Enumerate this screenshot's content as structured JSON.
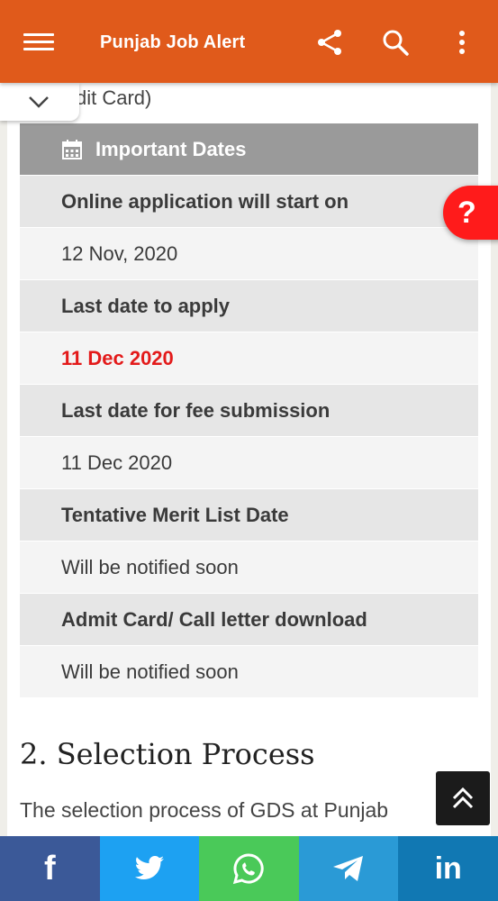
{
  "appbar": {
    "title": "Punjab Job Alert",
    "icons": [
      "menu-icon",
      "share-icon",
      "search-icon",
      "more-vert-icon"
    ]
  },
  "partial_text": "dit Card)",
  "table": {
    "heading": "Important Dates",
    "rows": [
      {
        "label": "Online application will start on",
        "value": "12 Nov, 2020"
      },
      {
        "label": "Last date to apply",
        "value": "11 Dec 2020"
      },
      {
        "label": "Last date for fee submission",
        "value": "11 Dec 2020"
      },
      {
        "label": "Tentative Merit List Date",
        "value": "Will be notified soon"
      },
      {
        "label": "Admit Card/ Call letter download",
        "value": "Will be notified soon"
      }
    ]
  },
  "help_button": "?",
  "section": {
    "title": "2. Selection Process",
    "text": "The selection process of GDS at Punjab"
  },
  "share": {
    "items": [
      {
        "name": "facebook",
        "label": "f",
        "color": "#3b5998"
      },
      {
        "name": "twitter",
        "color": "#1da1f2"
      },
      {
        "name": "whatsapp",
        "color": "#4ac959"
      },
      {
        "name": "telegram",
        "color": "#2a9ad6"
      },
      {
        "name": "linkedin",
        "label": "in",
        "color": "#1178b3"
      }
    ]
  },
  "colors": {
    "appbar": "#e05a1b",
    "alert": "#e31a1a",
    "header": "#9a9a9a"
  }
}
